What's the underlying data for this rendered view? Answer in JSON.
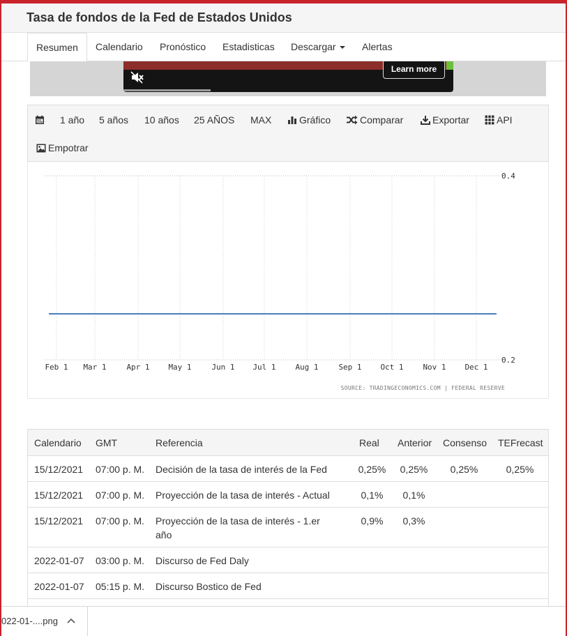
{
  "header": {
    "title": "Tasa de fondos de la Fed de Estados Unidos"
  },
  "tabs": [
    {
      "label": "Resumen",
      "active": true
    },
    {
      "label": "Calendario"
    },
    {
      "label": "Pronóstico"
    },
    {
      "label": "Estadisticas"
    },
    {
      "label": "Descargar"
    },
    {
      "label": "Alertas"
    }
  ],
  "ad": {
    "learn_more": "Learn more"
  },
  "toolbar": {
    "ranges": [
      "1 año",
      "5 años",
      "10 años",
      "25 AÑOS",
      "MAX"
    ],
    "grafico": "Gráfico",
    "comparar": "Comparar",
    "exportar": "Exportar",
    "api": "API",
    "empotrar": "Empotrar"
  },
  "chart_data": {
    "type": "line",
    "x": [
      "Feb 1",
      "Mar 1",
      "Apr 1",
      "May 1",
      "Jun 1",
      "Jul 1",
      "Aug 1",
      "Sep 1",
      "Oct 1",
      "Nov 1",
      "Dec 1"
    ],
    "series": [
      {
        "values": [
          0.25,
          0.25,
          0.25,
          0.25,
          0.25,
          0.25,
          0.25,
          0.25,
          0.25,
          0.25,
          0.25
        ]
      }
    ],
    "y_ticks": [
      "0.4",
      "0.2"
    ],
    "ylim": [
      0.2,
      0.4
    ],
    "grid": true,
    "line_color": "#4a7ebb",
    "source": "SOURCE: TRADINGECONOMICS.COM | FEDERAL RESERVE"
  },
  "calendar": {
    "headers": [
      "Calendario",
      "GMT",
      "Referencia",
      "Real",
      "Anterior",
      "Consenso",
      "TEFrecast"
    ],
    "rows": [
      [
        "15/12/2021",
        "07:00 p. M.",
        "Decisión de la tasa de interés de la Fed",
        "0,25%",
        "0,25%",
        "0,25%",
        "0,25%"
      ],
      [
        "15/12/2021",
        "07:00 p. M.",
        "Proyección de la tasa de interés - Actual",
        "0,1%",
        "0,1%",
        "",
        ""
      ],
      [
        "15/12/2021",
        "07:00 p. M.",
        "Proyección de la tasa de interés - 1.er año",
        "0,9%",
        "0,3%",
        "",
        ""
      ],
      [
        "2022-01-07",
        "03:00 p. M.",
        "Discurso de Fed Daly",
        "",
        "",
        "",
        ""
      ],
      [
        "2022-01-07",
        "05:15 p. M.",
        "Discurso Bostico de Fed",
        "",
        "",
        "",
        ""
      ]
    ]
  },
  "downloads": {
    "file_name": "022-01-....png"
  },
  "colors": {
    "accent": "#c8232b",
    "toolbar_bg": "#f5f5f5",
    "chart_line": "#4a7ebb"
  }
}
